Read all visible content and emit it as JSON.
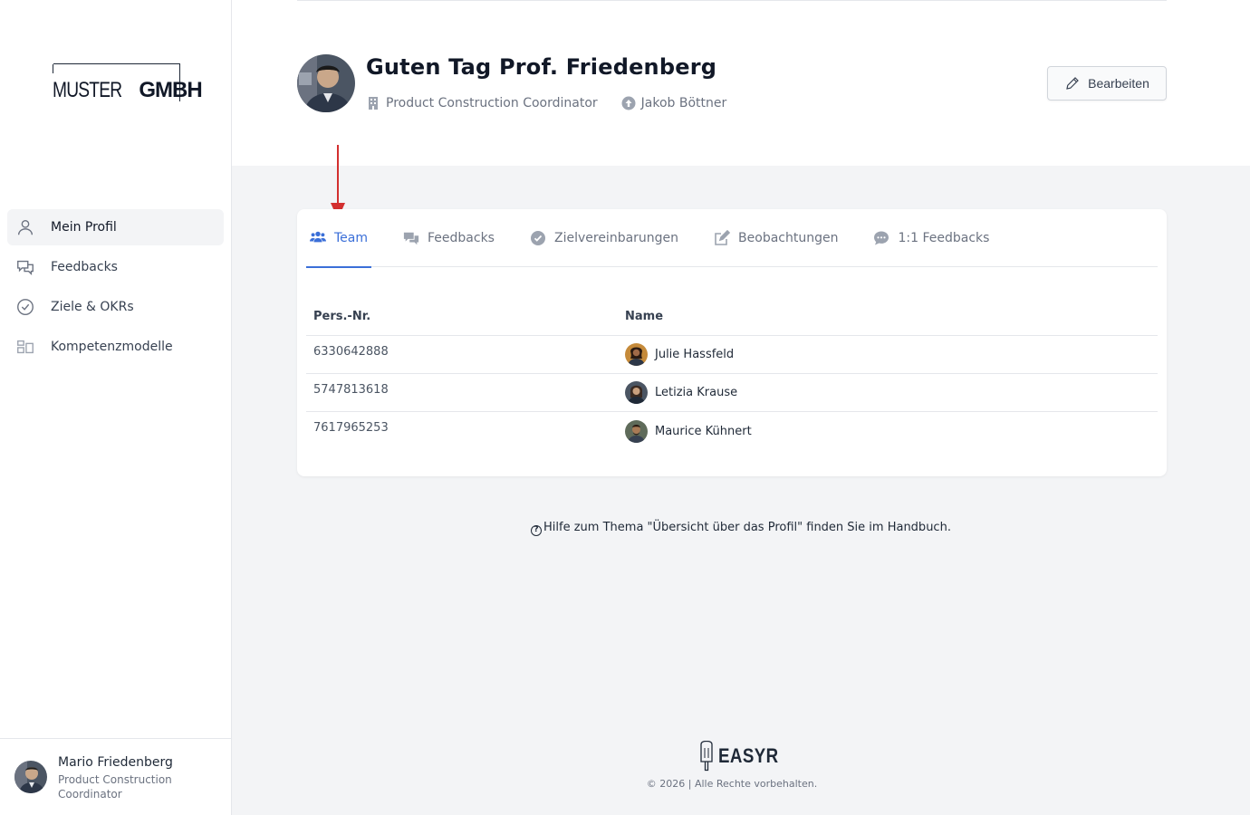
{
  "sidebar": {
    "logo": {
      "thin": "MUSTER",
      "bold": "GMBH"
    },
    "items": [
      {
        "label": "Mein Profil",
        "icon": "user-icon",
        "active": true
      },
      {
        "label": "Feedbacks",
        "icon": "chat-bubbles-icon",
        "active": false
      },
      {
        "label": "Ziele & OKRs",
        "icon": "check-circle-icon",
        "active": false
      },
      {
        "label": "Kompetenzmodelle",
        "icon": "grid-icon",
        "active": false
      }
    ],
    "user": {
      "name": "Mario Friedenberg",
      "role": "Product Construction Coordinator"
    }
  },
  "header": {
    "greeting": "Guten Tag Prof. Friedenberg",
    "position": "Product Construction Coordinator",
    "manager": "Jakob Böttner",
    "edit_label": "Bearbeiten"
  },
  "tabs": [
    {
      "label": "Team",
      "icon": "users-icon",
      "active": true
    },
    {
      "label": "Feedbacks",
      "icon": "comments-icon",
      "active": false
    },
    {
      "label": "Zielvereinbarungen",
      "icon": "check-circle-icon",
      "active": false
    },
    {
      "label": "Beobachtungen",
      "icon": "edit-icon",
      "active": false
    },
    {
      "label": "1:1 Feedbacks",
      "icon": "comment-dots-icon",
      "active": false
    }
  ],
  "table": {
    "columns": [
      "Pers.-Nr.",
      "Name"
    ],
    "rows": [
      {
        "nr": "6330642888",
        "name": "Julie Hassfeld"
      },
      {
        "nr": "5747813618",
        "name": "Letizia Krause"
      },
      {
        "nr": "7617965253",
        "name": "Maurice Kühnert"
      }
    ]
  },
  "help": {
    "text": "Hilfe zum Thema \"Übersicht über das Profil\" finden Sie im Handbuch."
  },
  "footer": {
    "brand": "EASYR",
    "copyright": "© 2026 | Alle Rechte vorbehalten."
  },
  "colors": {
    "accent": "#3b6fd8",
    "arrow": "#d32f2f"
  }
}
